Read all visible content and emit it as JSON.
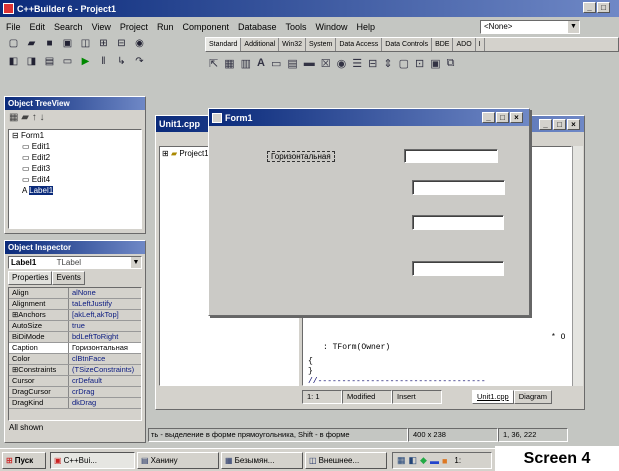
{
  "main_window": {
    "title": "C++Builder 6 - Project1"
  },
  "menu": [
    "File",
    "Edit",
    "Search",
    "View",
    "Project",
    "Run",
    "Component",
    "Database",
    "Tools",
    "Window",
    "Help"
  ],
  "desktop_combo": "<None>",
  "palette_tabs": [
    "Standard",
    "Additional",
    "Win32",
    "System",
    "Data Access",
    "Data Controls",
    "BDE",
    "ADO",
    "I"
  ],
  "treeview": {
    "title": "Object TreeView",
    "items": [
      "Form1",
      "Edit1",
      "Edit2",
      "Edit3",
      "Edit4",
      "Label1"
    ]
  },
  "inspector": {
    "title": "Object Inspector",
    "selected": "Label1",
    "selected_type": "TLabel",
    "tabs": [
      "Properties",
      "Events"
    ],
    "rows": [
      {
        "k": "Align",
        "v": "alNone"
      },
      {
        "k": "Alignment",
        "v": "taLeftJustify"
      },
      {
        "k": "⊞Anchors",
        "v": "[akLeft,akTop]"
      },
      {
        "k": "AutoSize",
        "v": "true"
      },
      {
        "k": "BiDiMode",
        "v": "bdLeftToRight"
      },
      {
        "k": "Caption",
        "v": "Горизонтальная"
      },
      {
        "k": "Color",
        "v": "clBtnFace"
      },
      {
        "k": "⊞Constraints",
        "v": "(TSizeConstraints)"
      },
      {
        "k": "Cursor",
        "v": "crDefault"
      },
      {
        "k": "DragCursor",
        "v": "crDrag"
      },
      {
        "k": "DragKind",
        "v": "dkDrag"
      }
    ],
    "footer": "All shown"
  },
  "form": {
    "title": "Form1",
    "label_caption": "Горизонтальная"
  },
  "editor": {
    "title": "Unit1.cpp",
    "tree_node": "Project1",
    "code_lines": [
      ": TForm(Owner)",
      "{",
      "}"
    ],
    "code_comment": "//-----------------------------------",
    "code_right": "* O",
    "status": [
      "1: 1",
      "Modified",
      "Insert"
    ],
    "tabs": [
      "Unit1.cpp",
      "Diagram"
    ]
  },
  "statusbar": {
    "hint": "ть - выделение в форме прямоугольника, Shift - в форме",
    "size": "400 x 238",
    "pos": "1, 36, 222"
  },
  "taskbar": {
    "start": "Пуск",
    "buttons": [
      "C++Bui...",
      "Ханину",
      "Безымян...",
      "Внешнее..."
    ],
    "clock": "1:"
  },
  "overlay_caption": "Screen 4"
}
